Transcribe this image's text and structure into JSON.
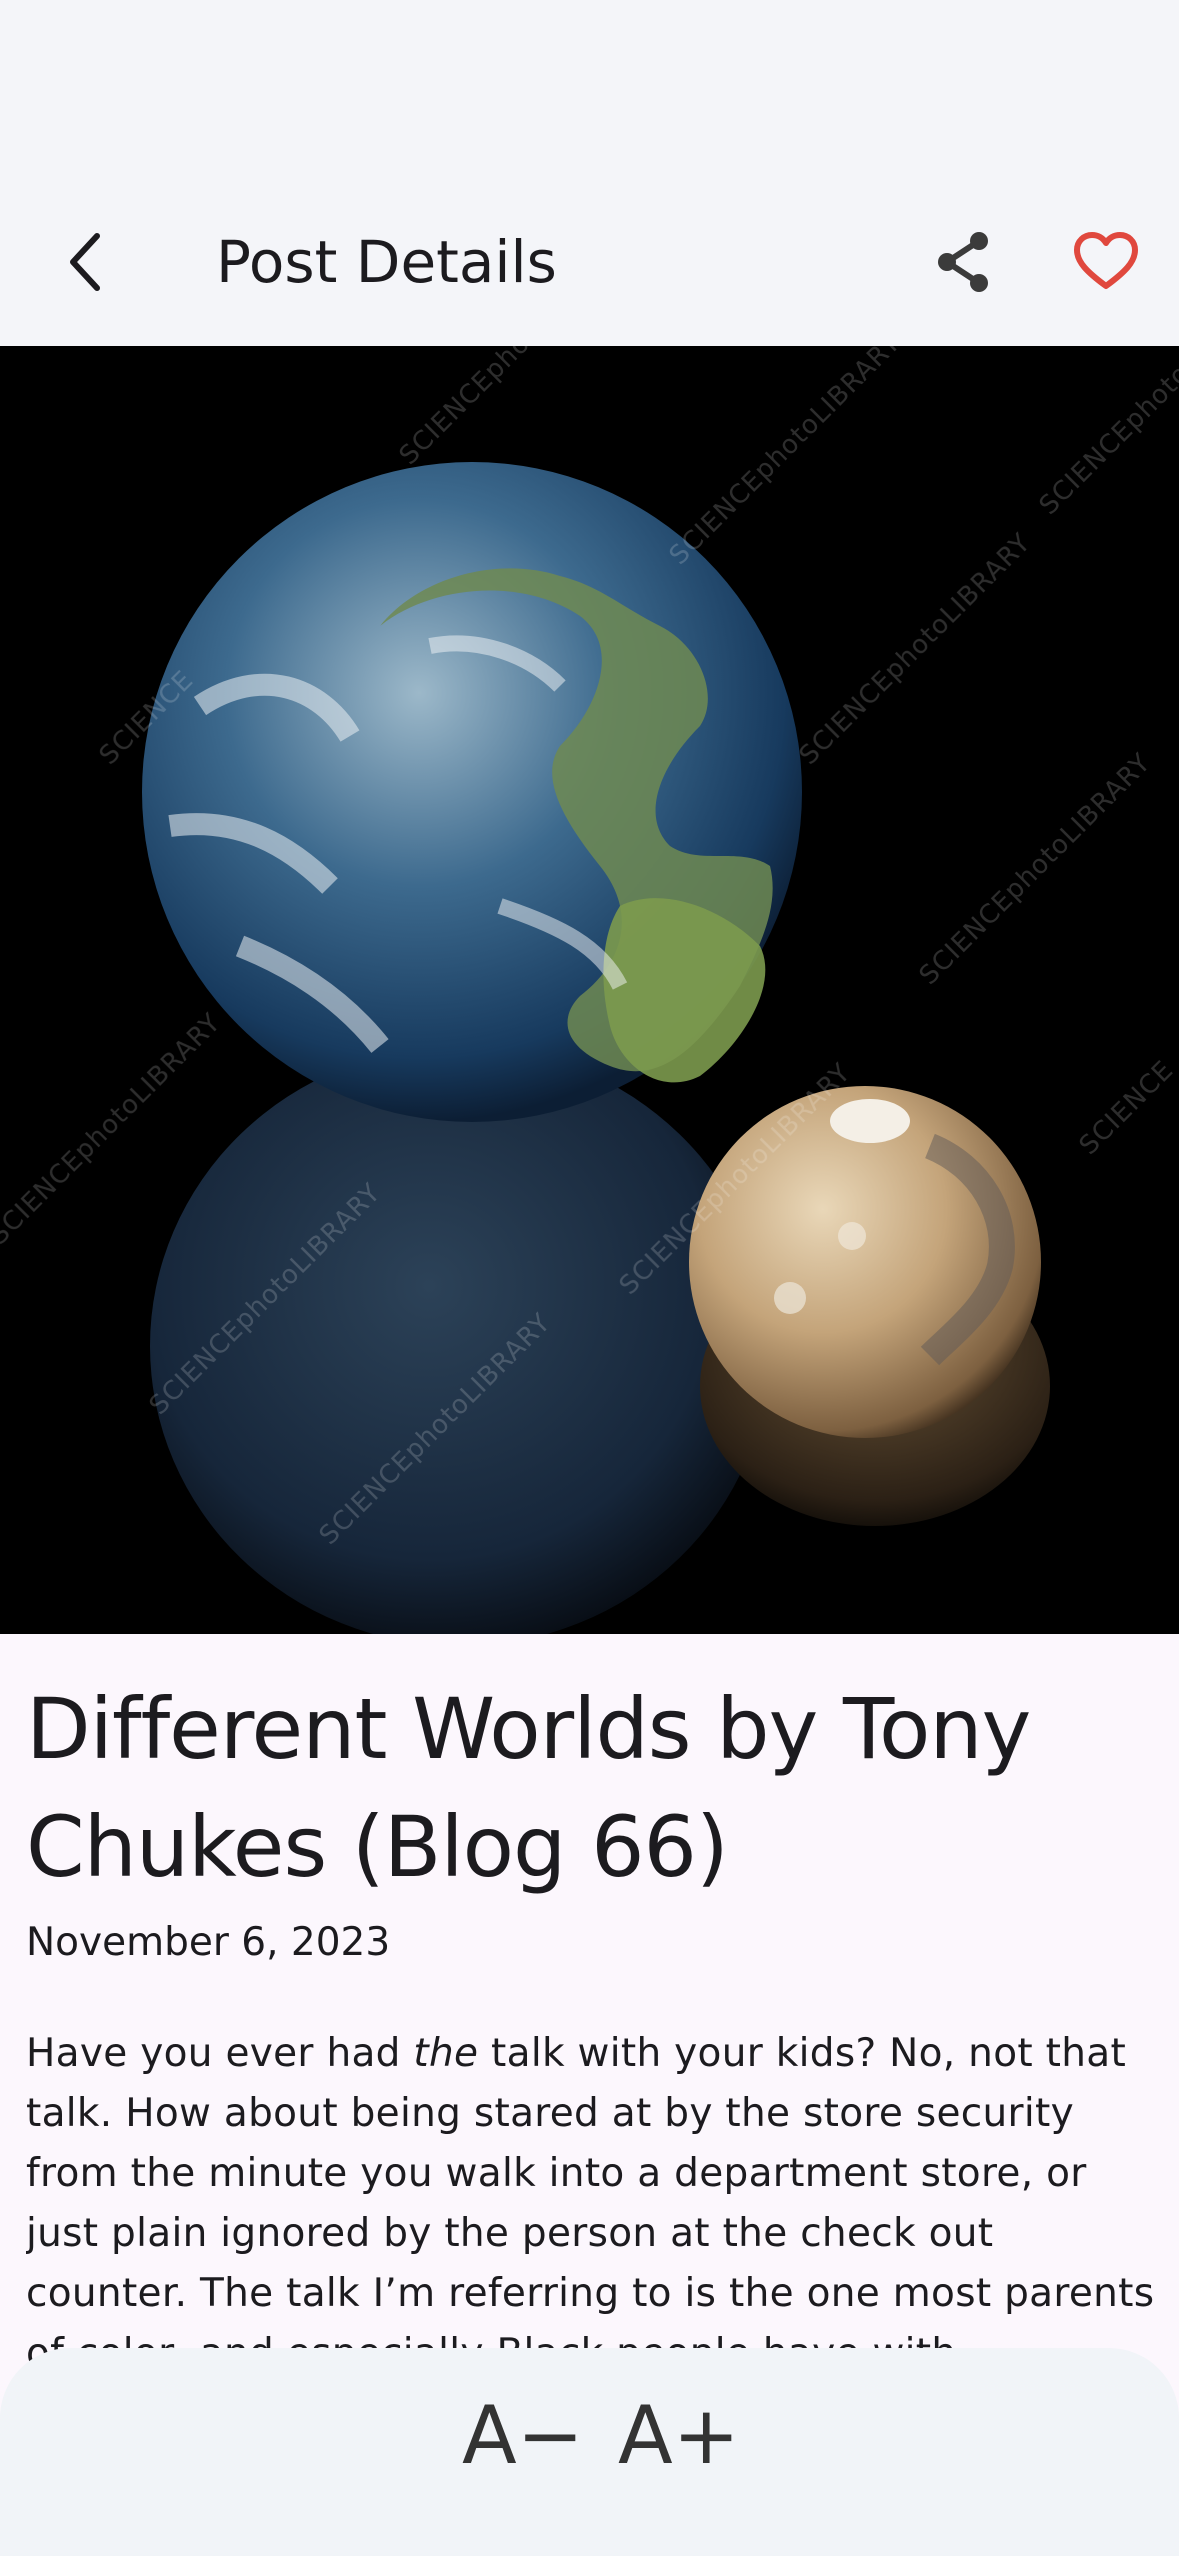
{
  "app_bar": {
    "title": "Post Details",
    "icons": {
      "back": "back-arrow-icon",
      "share": "share-icon",
      "favorite": "heart-outline-icon"
    },
    "favorite_color": "#e0483e"
  },
  "hero_image": {
    "description_icon": "earth-and-mars-image",
    "watermark": "SCIENCEphotoLIBRARY"
  },
  "post": {
    "title": "Different Worlds by Tony Chukes (Blog 66)",
    "date": "November 6, 2023",
    "body_before_em": "Have you ever had ",
    "body_em": "the",
    "body_after_em": " talk with your kids?  No, not that talk.  How about being stared at by the store security from the minute you walk into a department store, or just plain ignored by the person at the check out counter.  The talk I’m referring to is the one most parents of color, and especially Black people have with"
  },
  "font_controls": {
    "decrease_label": "A−",
    "increase_label": "A+"
  }
}
